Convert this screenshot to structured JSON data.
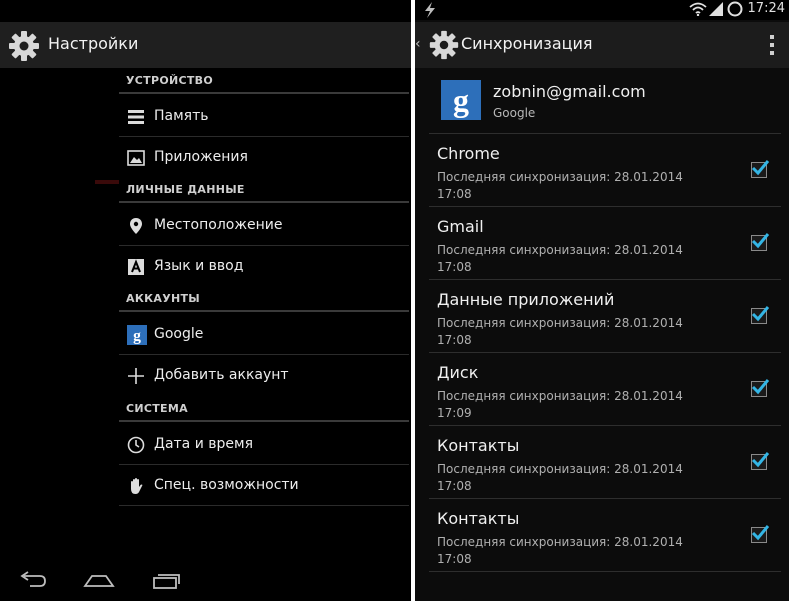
{
  "left": {
    "title": "Настройки",
    "sections": [
      {
        "header": "УСТРОЙСТВО",
        "items": [
          {
            "label": "Память",
            "icon": "storage-icon"
          },
          {
            "label": "Приложения",
            "icon": "apps-icon"
          }
        ]
      },
      {
        "header": "ЛИЧНЫЕ ДАННЫЕ",
        "items": [
          {
            "label": "Местоположение",
            "icon": "location-icon"
          },
          {
            "label": "Язык и ввод",
            "icon": "language-icon"
          }
        ]
      },
      {
        "header": "АККАУНТЫ",
        "items": [
          {
            "label": "Google",
            "icon": "google-icon"
          },
          {
            "label": "Добавить аккаунт",
            "icon": "plus-icon"
          }
        ]
      },
      {
        "header": "СИСТЕМА",
        "items": [
          {
            "label": "Дата и время",
            "icon": "clock-icon"
          },
          {
            "label": "Спец. возможности",
            "icon": "hand-icon"
          }
        ]
      }
    ],
    "nav": [
      "back-icon",
      "home-icon",
      "recent-apps-icon"
    ]
  },
  "right": {
    "status_time": "17:24",
    "title": "Синхронизация",
    "account": {
      "email": "zobnin@gmail.com",
      "provider": "Google"
    },
    "sync_items": [
      {
        "name": "Chrome",
        "desc_line1": "Последняя синхронизация: 28.01.2014",
        "desc_line2": "17:08",
        "checked": true
      },
      {
        "name": "Gmail",
        "desc_line1": "Последняя синхронизация: 28.01.2014",
        "desc_line2": "17:08",
        "checked": true
      },
      {
        "name": "Данные приложений",
        "desc_line1": "Последняя синхронизация: 28.01.2014",
        "desc_line2": "17:08",
        "checked": true
      },
      {
        "name": "Диск",
        "desc_line1": "Последняя синхронизация: 28.01.2014",
        "desc_line2": "17:09",
        "checked": true
      },
      {
        "name": "Контакты",
        "desc_line1": "Последняя синхронизация: 28.01.2014",
        "desc_line2": "17:08",
        "checked": true
      },
      {
        "name": "Контакты",
        "desc_line1": "Последняя синхронизация: 28.01.2014",
        "desc_line2": "17:08",
        "checked": true
      }
    ]
  },
  "colors": {
    "checkmark": "#33b5e5",
    "google_blue": "#2d6fba"
  }
}
